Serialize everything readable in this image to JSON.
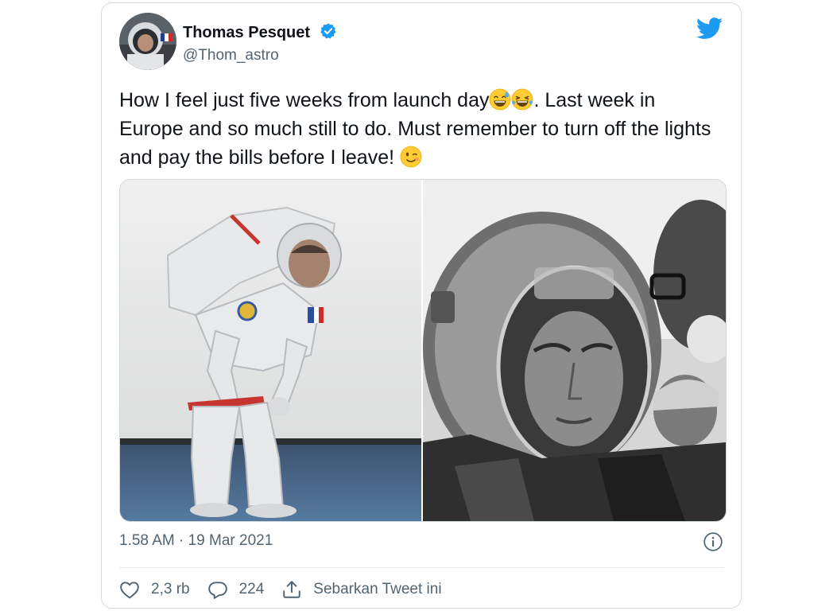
{
  "tweet": {
    "author": {
      "display_name": "Thomas Pesquet",
      "handle": "@Thom_astro",
      "verified": true
    },
    "text_parts": {
      "part1": "How I feel just five weeks from launch day",
      "part2": ". Last week in Europe and so much still to do. Must remember to turn off the lights and pay the bills before I leave! "
    },
    "emojis": [
      "sweat-smile-emoji",
      "tears-of-joy-emoji",
      "winking-face-emoji"
    ],
    "media": [
      {
        "name": "astronaut-bent-over-photo"
      },
      {
        "name": "astronaut-helmet-closeup-photo"
      }
    ],
    "timestamp": "1.58 AM · 19 Mar 2021",
    "actions": {
      "like_count": "2,3 rb",
      "reply_count": "224",
      "share_label": "Sebarkan Tweet ini"
    }
  },
  "colors": {
    "brand": "#1d9bf0",
    "text": "#0f1419",
    "secondary_text": "#536471",
    "border": "#d6dce0"
  }
}
